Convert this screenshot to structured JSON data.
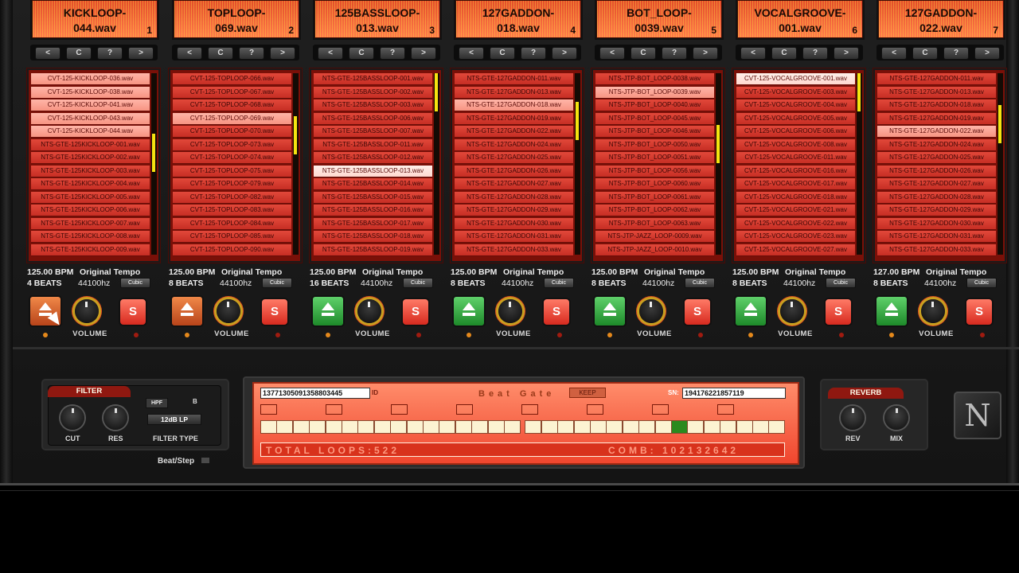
{
  "channels": [
    {
      "name": "KICKLOOP-\n044.wav",
      "num": "1",
      "bpm": "125.00 BPM",
      "tempo_label": "Original Tempo",
      "beats": "4 BEATS",
      "hz": "44100hz",
      "interp": "Cubic",
      "volume_label": "VOLUME",
      "solo_label": "S",
      "load_state": "orange",
      "files": [
        "CVT-125-KICKLOOP-036.wav",
        "CVT-125-KICKLOOP-038.wav",
        "CVT-125-KICKLOOP-041.wav",
        "CVT-125-KICKLOOP-043.wav",
        "CVT-125-KICKLOOP-044.wav",
        "NTS-GTE-125KICKLOOP-001.wav",
        "NTS-GTE-125KICKLOOP-002.wav",
        "NTS-GTE-125KICKLOOP-003.wav",
        "NTS-GTE-125KICKLOOP-004.wav",
        "NTS-GTE-125KICKLOOP-005.wav",
        "NTS-GTE-125KICKLOOP-006.wav",
        "NTS-GTE-125KICKLOOP-007.wav",
        "NTS-GTE-125KICKLOOP-008.wav",
        "NTS-GTE-125KICKLOOP-009.wav"
      ],
      "file_styles": [
        "pink",
        "pink",
        "pink",
        "pink",
        "pink",
        "",
        "",
        "",
        "",
        "",
        "",
        "",
        "",
        ""
      ],
      "scroll_pos": 0.42
    },
    {
      "name": "TOPLOOP-\n069.wav",
      "num": "2",
      "bpm": "125.00 BPM",
      "tempo_label": "Original Tempo",
      "beats": "8 BEATS",
      "hz": "44100hz",
      "interp": "Cubic",
      "volume_label": "VOLUME",
      "solo_label": "S",
      "load_state": "orange",
      "files": [
        "CVT-125-TOPLOOP-066.wav",
        "CVT-125-TOPLOOP-067.wav",
        "CVT-125-TOPLOOP-068.wav",
        "CVT-125-TOPLOOP-069.wav",
        "CVT-125-TOPLOOP-070.wav",
        "CVT-125-TOPLOOP-073.wav",
        "CVT-125-TOPLOOP-074.wav",
        "CVT-125-TOPLOOP-075.wav",
        "CVT-125-TOPLOOP-079.wav",
        "CVT-125-TOPLOOP-082.wav",
        "CVT-125-TOPLOOP-083.wav",
        "CVT-125-TOPLOOP-084.wav",
        "CVT-125-TOPLOOP-085.wav",
        "CVT-125-TOPLOOP-090.wav"
      ],
      "file_styles": [
        "",
        "",
        "",
        "pink",
        "",
        "",
        "",
        "",
        "",
        "",
        "",
        "",
        "",
        ""
      ],
      "scroll_pos": 0.3
    },
    {
      "name": "125BASSLOOP-\n013.wav",
      "num": "3",
      "bpm": "125.00 BPM",
      "tempo_label": "Original Tempo",
      "beats": "16 BEATS",
      "hz": "44100hz",
      "interp": "Cubic",
      "volume_label": "VOLUME",
      "solo_label": "S",
      "load_state": "green",
      "files": [
        "NTS-GTE-125BASSLOOP-001.wav",
        "NTS-GTE-125BASSLOOP-002.wav",
        "NTS-GTE-125BASSLOOP-003.wav",
        "NTS-GTE-125BASSLOOP-006.wav",
        "NTS-GTE-125BASSLOOP-007.wav",
        "NTS-GTE-125BASSLOOP-011.wav",
        "NTS-GTE-125BASSLOOP-012.wav",
        "NTS-GTE-125BASSLOOP-013.wav",
        "NTS-GTE-125BASSLOOP-014.wav",
        "NTS-GTE-125BASSLOOP-015.wav",
        "NTS-GTE-125BASSLOOP-016.wav",
        "NTS-GTE-125BASSLOOP-017.wav",
        "NTS-GTE-125BASSLOOP-018.wav",
        "NTS-GTE-125BASSLOOP-019.wav"
      ],
      "file_styles": [
        "",
        "",
        "",
        "",
        "",
        "",
        "",
        "light",
        "",
        "",
        "",
        "",
        "",
        ""
      ],
      "scroll_pos": 0.0
    },
    {
      "name": "127GADDON-\n018.wav",
      "num": "4",
      "bpm": "125.00 BPM",
      "tempo_label": "Original Tempo",
      "beats": "8 BEATS",
      "hz": "44100hz",
      "interp": "Cubic",
      "volume_label": "VOLUME",
      "solo_label": "S",
      "load_state": "green",
      "files": [
        "NTS-GTE-127GADDON-011.wav",
        "NTS-GTE-127GADDON-013.wav",
        "NTS-GTE-127GADDON-018.wav",
        "NTS-GTE-127GADDON-019.wav",
        "NTS-GTE-127GADDON-022.wav",
        "NTS-GTE-127GADDON-024.wav",
        "NTS-GTE-127GADDON-025.wav",
        "NTS-GTE-127GADDON-026.wav",
        "NTS-GTE-127GADDON-027.wav",
        "NTS-GTE-127GADDON-028.wav",
        "NTS-GTE-127GADDON-029.wav",
        "NTS-GTE-127GADDON-030.wav",
        "NTS-GTE-127GADDON-031.wav",
        "NTS-GTE-127GADDON-033.wav"
      ],
      "file_styles": [
        "",
        "",
        "pink",
        "",
        "",
        "",
        "",
        "",
        "",
        "",
        "",
        "",
        "",
        ""
      ],
      "scroll_pos": 0.2
    },
    {
      "name": "BOT_LOOP-\n0039.wav",
      "num": "5",
      "bpm": "125.00 BPM",
      "tempo_label": "Original Tempo",
      "beats": "8 BEATS",
      "hz": "44100hz",
      "interp": "Cubic",
      "volume_label": "VOLUME",
      "solo_label": "S",
      "load_state": "green",
      "files": [
        "NTS-JTP-BOT_LOOP-0038.wav",
        "NTS-JTP-BOT_LOOP-0039.wav",
        "NTS-JTP-BOT_LOOP-0040.wav",
        "NTS-JTP-BOT_LOOP-0045.wav",
        "NTS-JTP-BOT_LOOP-0046.wav",
        "NTS-JTP-BOT_LOOP-0050.wav",
        "NTS-JTP-BOT_LOOP-0051.wav",
        "NTS-JTP-BOT_LOOP-0056.wav",
        "NTS-JTP-BOT_LOOP-0060.wav",
        "NTS-JTP-BOT_LOOP-0061.wav",
        "NTS-JTP-BOT_LOOP-0062.wav",
        "NTS-JTP-BOT_LOOP-0063.wav",
        "NTS-JTP-JAZZ_LOOP-0009.wav",
        "NTS-JTP-JAZZ_LOOP-0010.wav"
      ],
      "file_styles": [
        "",
        "pink",
        "",
        "",
        "",
        "",
        "",
        "",
        "",
        "",
        "",
        "",
        "",
        ""
      ],
      "scroll_pos": 0.36
    },
    {
      "name": "VOCALGROOVE-\n001.wav",
      "num": "6",
      "bpm": "125.00 BPM",
      "tempo_label": "Original Tempo",
      "beats": "8 BEATS",
      "hz": "44100hz",
      "interp": "Cubic",
      "volume_label": "VOLUME",
      "solo_label": "S",
      "load_state": "green",
      "files": [
        "CVT-125-VOCALGROOVE-001.wav",
        "CVT-125-VOCALGROOVE-003.wav",
        "CVT-125-VOCALGROOVE-004.wav",
        "CVT-125-VOCALGROOVE-005.wav",
        "CVT-125-VOCALGROOVE-006.wav",
        "CVT-125-VOCALGROOVE-008.wav",
        "CVT-125-VOCALGROOVE-011.wav",
        "CVT-125-VOCALGROOVE-016.wav",
        "CVT-125-VOCALGROOVE-017.wav",
        "CVT-125-VOCALGROOVE-018.wav",
        "CVT-125-VOCALGROOVE-021.wav",
        "CVT-125-VOCALGROOVE-022.wav",
        "CVT-125-VOCALGROOVE-023.wav",
        "CVT-125-VOCALGROOVE-027.wav"
      ],
      "file_styles": [
        "light",
        "",
        "",
        "",
        "",
        "",
        "",
        "",
        "",
        "",
        "",
        "",
        "",
        ""
      ],
      "scroll_pos": 0.0
    },
    {
      "name": "127GADDON-\n022.wav",
      "num": "7",
      "bpm": "127.00 BPM",
      "tempo_label": "Original Tempo",
      "beats": "8 BEATS",
      "hz": "44100hz",
      "interp": "Cubic",
      "volume_label": "VOLUME",
      "solo_label": "S",
      "load_state": "green",
      "files": [
        "NTS-GTE-127GADDON-011.wav",
        "NTS-GTE-127GADDON-013.wav",
        "NTS-GTE-127GADDON-018.wav",
        "NTS-GTE-127GADDON-019.wav",
        "NTS-GTE-127GADDON-022.wav",
        "NTS-GTE-127GADDON-024.wav",
        "NTS-GTE-127GADDON-025.wav",
        "NTS-GTE-127GADDON-026.wav",
        "NTS-GTE-127GADDON-027.wav",
        "NTS-GTE-127GADDON-028.wav",
        "NTS-GTE-127GADDON-029.wav",
        "NTS-GTE-127GADDON-030.wav",
        "NTS-GTE-127GADDON-031.wav",
        "NTS-GTE-127GADDON-033.wav"
      ],
      "file_styles": [
        "",
        "",
        "",
        "",
        "pink",
        "",
        "",
        "",
        "",
        "",
        "",
        "",
        "",
        ""
      ],
      "scroll_pos": 0.22
    }
  ],
  "nav_buttons": [
    "<",
    "C",
    "?",
    ">"
  ],
  "filter": {
    "title": "FILTER",
    "cut_label": "CUT",
    "res_label": "RES",
    "hpf_label": "HPF",
    "b_label": "B",
    "type_value": "12dB LP",
    "type_label": "FILTER TYPE",
    "beatstep_label": "Beat/Step"
  },
  "gate": {
    "id_value": "137713050913588034​45",
    "id_label": "ID",
    "title": "Beat Gate",
    "keep_label": "KEEP",
    "sn_label": "SN:",
    "sn_value": "194176221857119",
    "total_text": "TOTAL LOOPS:522",
    "comb_text": "COMB: 102132642",
    "active_step": 25,
    "marker_count": 8,
    "step_count": 32
  },
  "reverb": {
    "title": "REVERB",
    "rev_label": "REV",
    "mix_label": "MIX"
  },
  "logo_letter": "N",
  "colors": {
    "accent": "#e03020",
    "load_orange": "#d0602a",
    "load_green": "#2fa83a",
    "scroll": "#f5e410"
  },
  "icons": {
    "eject": "eject-icon",
    "solo": "solo-icon",
    "cursor": "hand-cursor-icon"
  }
}
